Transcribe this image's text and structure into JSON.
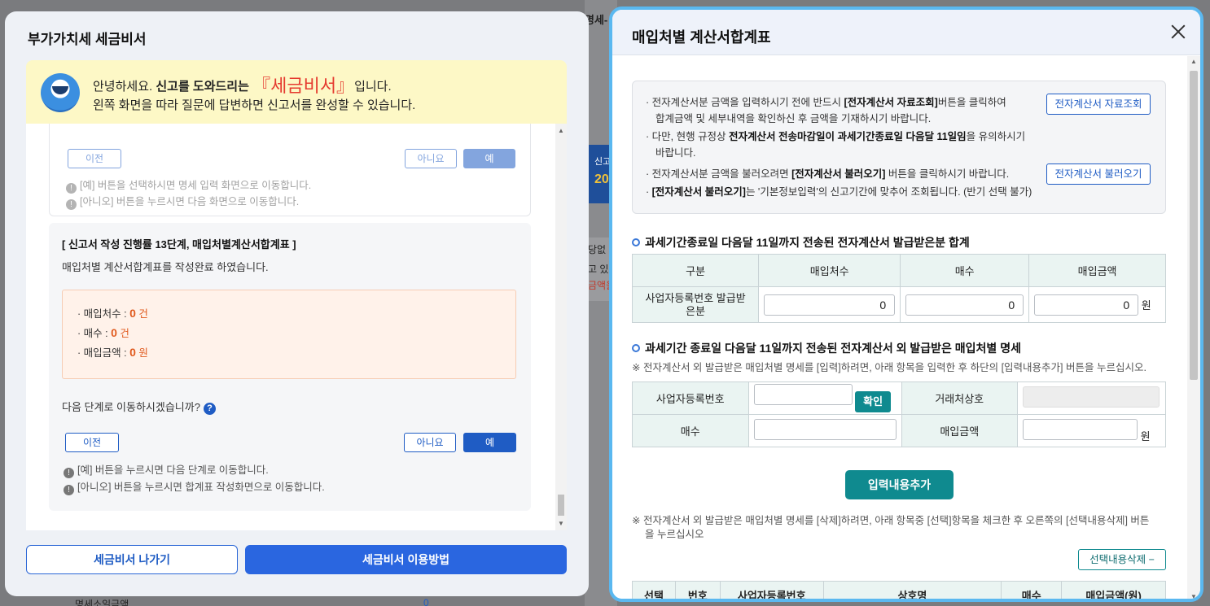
{
  "background": {
    "partial_title": "명세-",
    "side_texts": [
      "신고",
      "20",
      "당없",
      "고 있",
      "금액을"
    ],
    "bottom_label": "명세소일금액",
    "bottom_value": "0"
  },
  "assistant": {
    "title": "부가가치세 세금비서",
    "banner": {
      "greeting": "안녕하세요. ",
      "help_text": "신고를 도와드리는 ",
      "brand": "『세금비서』",
      "tail": "입니다.",
      "line2": "왼쪽 화면을 따라 질문에 답변하면 신고서를 완성할 수 있습니다."
    },
    "prev_card": {
      "prev_label": "이전",
      "no_label": "아니요",
      "yes_label": "예",
      "note1": "[예] 버튼을 선택하시면 명세 입력 화면으로 이동합니다.",
      "note2": "[아니오] 버튼을 누르시면 다음 화면으로 이동합니다."
    },
    "step_card": {
      "heading": "[ 신고서 작성 진행률 13단계, 매입처별계산서합계표 ]",
      "subtitle": "매입처별 계산서합계표를 작성완료 하였습니다.",
      "rows": [
        {
          "label": "· 매입처수 : ",
          "value": "0",
          "unit": " 건"
        },
        {
          "label": "· 매수 : ",
          "value": "0",
          "unit": " 건"
        },
        {
          "label": "· 매입금액 : ",
          "value": "0",
          "unit": " 원"
        }
      ],
      "question": "다음 단계로 이동하시겠습니까?",
      "help_glyph": "?",
      "prev_label": "이전",
      "no_label": "아니요",
      "yes_label": "예",
      "note1": "[예] 버튼을 누르시면 다음 단계로 이동합니다.",
      "note2": "[아니오] 버튼을 누르시면 합계표 작성화면으로 이동합니다."
    },
    "footer": {
      "exit_label": "세금비서 나가기",
      "howto_label": "세금비서 이용방법"
    }
  },
  "modal": {
    "title": "매입처별 계산서합계표",
    "info": {
      "line1a": "전자계산서분 금액을 입력하시기 전에 반드시 ",
      "line1b": "[전자계산서 자료조회]",
      "line1c": "버튼을 클릭하여",
      "line2": "합계금액 및 세부내역을 확인하신 후 금액을 기재하시기 바랍니다.",
      "line3a": "다만, 현행 규정상 ",
      "line3b": "전자계산서 전송마감일이 과세기간종료일 다음달 11일임",
      "line3c": "을 유의하시기",
      "line4": "바랍니다.",
      "line5a": "전자계산서분 금액을 불러오려면 ",
      "line5b": "[전자계산서 불러오기]",
      "line5c": " 버튼을 클릭하시기 바랍니다.",
      "line6a": "[전자계산서 불러오기]",
      "line6b": "는 '기본정보입력'의 신고기간에 맞추어 조회됩니다. (반기 선택 불가)",
      "btn_query": "전자계산서 자료조회",
      "btn_load": "전자계산서 불러오기"
    },
    "section1": {
      "title": "과세기간종료일 다음달 11일까지 전송된 전자계산서 발급받은분 합계",
      "headers": [
        "구분",
        "매입처수",
        "매수",
        "매입금액"
      ],
      "row_label": "사업자등록번호 발급받은분",
      "vendors": "0",
      "count": "0",
      "amount": "0",
      "unit": "원"
    },
    "section2": {
      "title": "과세기간 종료일 다음달 11일까지 전송된 전자계산서 외 발급받은 매입처별 명세",
      "note": "※ 전자계산서 외 발급받은 매입처별 명세를 [입력]하려면, 아래 항목을 입력한 후 하단의 [입력내용추가] 버튼을 누르십시오.",
      "biz_no_label": "사업자등록번호",
      "confirm_label": "확인",
      "trade_name_label": "거래처상호",
      "count_label": "매수",
      "amount_label": "매입금액",
      "unit": "원",
      "add_label": "입력내용추가",
      "delete_note_1": "※ 전자계산서 외 발급받은 매입처별 명세를 [삭제]하려면, 아래 항목중 [선택]항목을 체크한 후 오른쪽의 [선택내용삭제] 버튼",
      "delete_note_2": "을 누르십시오",
      "delete_label": "선택내용삭제 −",
      "list_headers": [
        "선택",
        "번호",
        "사업자등록번호",
        "상호명",
        "매수",
        "매입금액(원)"
      ]
    }
  }
}
